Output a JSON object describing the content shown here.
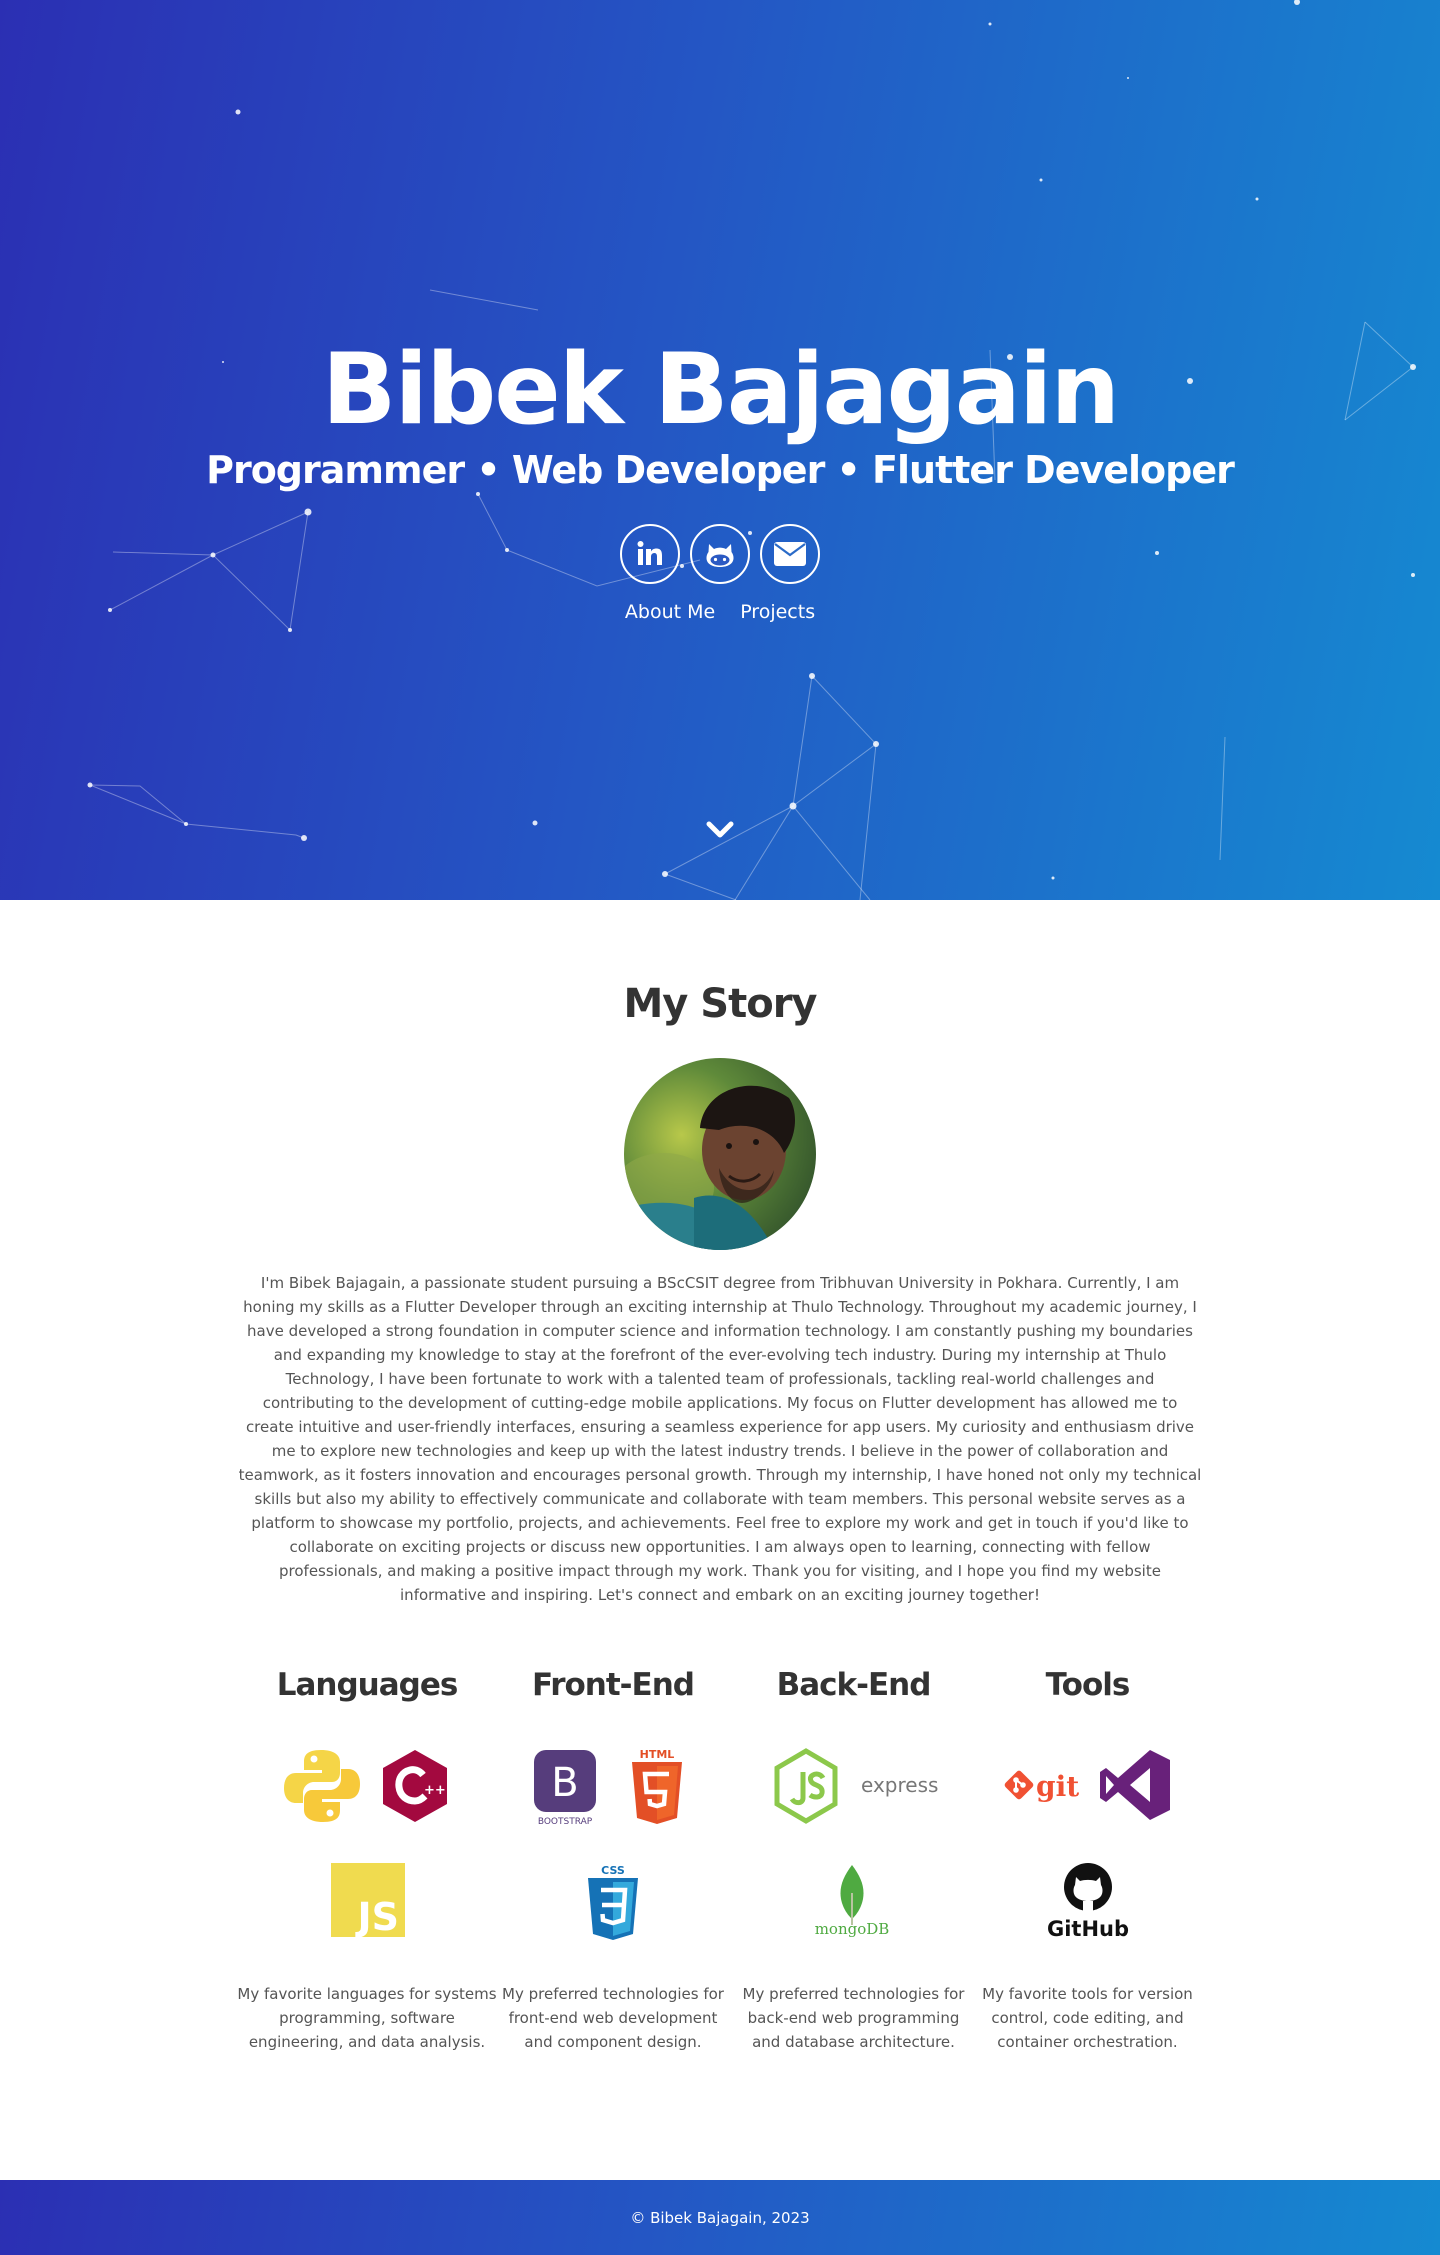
{
  "hero": {
    "name": "Bibek Bajagain",
    "subtitle": "Programmer • Web Developer • Flutter Developer",
    "social": [
      {
        "icon": "linkedin-icon"
      },
      {
        "icon": "github-icon"
      },
      {
        "icon": "envelope-icon"
      }
    ],
    "nav": {
      "about": "About Me",
      "projects": "Projects"
    },
    "scroll_icon": "chevron-down-icon"
  },
  "story": {
    "title": "My Story",
    "text": "I'm Bibek Bajagain, a passionate student pursuing a BScCSIT degree from Tribhuvan University in Pokhara. Currently, I am honing my skills as a Flutter Developer through an exciting internship at Thulo Technology. Throughout my academic journey, I have developed a strong foundation in computer science and information technology. I am constantly pushing my boundaries and expanding my knowledge to stay at the forefront of the ever-evolving tech industry. During my internship at Thulo Technology, I have been fortunate to work with a talented team of professionals, tackling real-world challenges and contributing to the development of cutting-edge mobile applications. My focus on Flutter development has allowed me to create intuitive and user-friendly interfaces, ensuring a seamless experience for app users. My curiosity and enthusiasm drive me to explore new technologies and keep up with the latest industry trends. I believe in the power of collaboration and teamwork, as it fosters innovation and encourages personal growth. Through my internship, I have honed not only my technical skills but also my ability to effectively communicate and collaborate with team members. This personal website serves as a platform to showcase my portfolio, projects, and achievements. Feel free to explore my work and get in touch if you'd like to collaborate on exciting projects or discuss new opportunities. I am always open to learning, connecting with fellow professionals, and making a positive impact through my work. Thank you for visiting, and I hope you find my website informative and inspiring. Let's connect and embark on an exciting journey together!"
  },
  "skills": {
    "languages": {
      "title": "Languages",
      "desc": "My favorite languages for systems programming, software engineering, and data analysis.",
      "logos": [
        "python-logo",
        "cplusplus-logo",
        "javascript-logo"
      ]
    },
    "frontend": {
      "title": "Front-End",
      "desc": "My preferred technologies for front-end web development and component design.",
      "logos": [
        "bootstrap-logo",
        "html5-logo",
        "css3-logo"
      ],
      "logo_text": {
        "bootstrap_letter": "B",
        "bootstrap": "BOOTSTRAP",
        "html": "HTML",
        "css": "CSS"
      }
    },
    "backend": {
      "title": "Back-End",
      "desc": "My preferred technologies for back-end web programming and database architecture.",
      "logos": [
        "nodejs-logo",
        "express-logo",
        "mongodb-logo"
      ],
      "logo_text": {
        "express": "express",
        "mongodb": "mongoDB",
        "js": "JS"
      }
    },
    "tools": {
      "title": "Tools",
      "desc": "My favorite tools for version control, code editing, and container orchestration.",
      "logos": [
        "git-logo",
        "visual-studio-logo",
        "github-logo"
      ],
      "logo_text": {
        "git": "git",
        "github": "GitHub"
      }
    }
  },
  "footer": {
    "copyright": "© Bibek Bajagain, 2023"
  },
  "colors": {
    "gradient_start": "#2b2fb3",
    "gradient_mid": "#2456c4",
    "gradient_end": "#158ad1",
    "heading": "#333333",
    "body_text": "#555555"
  }
}
